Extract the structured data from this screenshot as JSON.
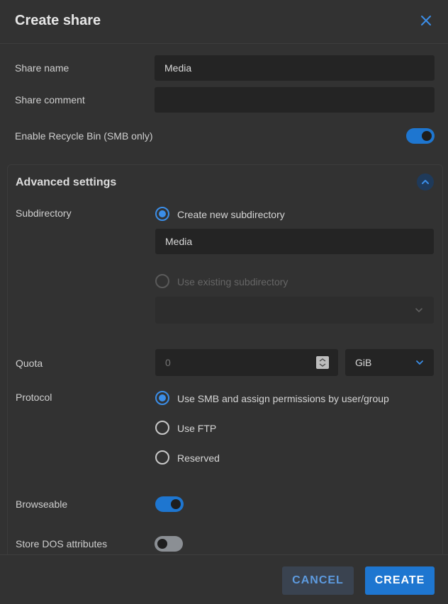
{
  "dialog": {
    "title": "Create share"
  },
  "form": {
    "share_name_label": "Share name",
    "share_name_value": "Media",
    "share_comment_label": "Share comment",
    "share_comment_value": "",
    "recycle_bin_label": "Enable Recycle Bin (SMB only)",
    "recycle_bin_enabled": true
  },
  "advanced": {
    "title": "Advanced settings",
    "subdirectory_label": "Subdirectory",
    "create_new_label": "Create new subdirectory",
    "new_subdirectory_value": "Media",
    "use_existing_label": "Use existing subdirectory",
    "existing_subdirectory_value": "",
    "quota_label": "Quota",
    "quota_placeholder": "0",
    "quota_unit": "GiB",
    "protocol_label": "Protocol",
    "protocol_options": [
      {
        "label": "Use SMB and assign permissions by user/group",
        "checked": true
      },
      {
        "label": "Use FTP",
        "checked": false
      },
      {
        "label": "Reserved",
        "checked": false
      }
    ],
    "browseable_label": "Browseable",
    "browseable_enabled": true,
    "dos_attributes_label": "Store DOS attributes",
    "dos_attributes_enabled": false
  },
  "footer": {
    "cancel_label": "CANCEL",
    "create_label": "CREATE"
  },
  "colors": {
    "accent": "#1e76d0",
    "background": "#323232",
    "field_background": "#242424"
  }
}
